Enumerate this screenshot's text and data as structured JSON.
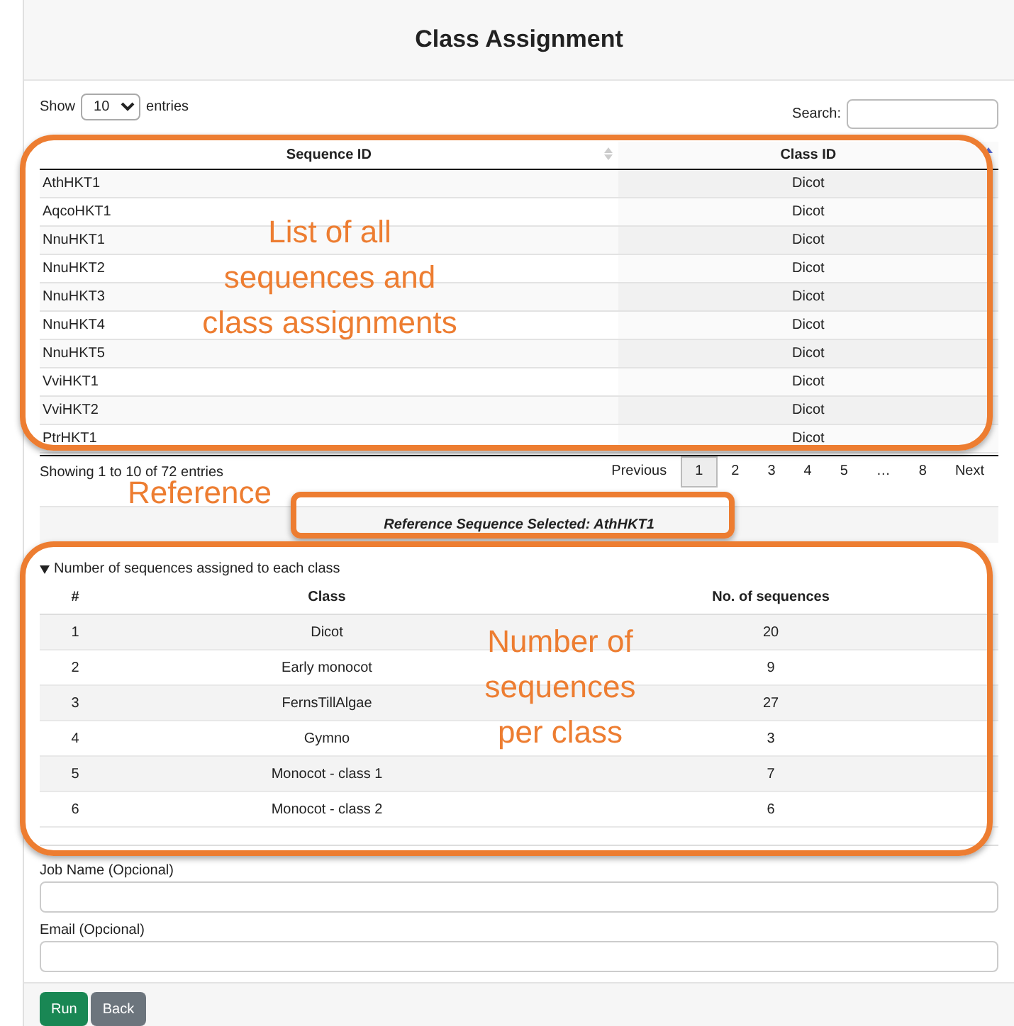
{
  "title": "Class Assignment",
  "length_menu": {
    "label_before": "Show",
    "value": "10",
    "label_after": "entries"
  },
  "search": {
    "label": "Search:"
  },
  "table": {
    "columns": [
      {
        "label": "Sequence ID",
        "sorted": false
      },
      {
        "label": "Class ID",
        "sorted": true
      }
    ],
    "rows": [
      [
        "AthHKT1",
        "Dicot"
      ],
      [
        "AqcoHKT1",
        "Dicot"
      ],
      [
        "NnuHKT1",
        "Dicot"
      ],
      [
        "NnuHKT2",
        "Dicot"
      ],
      [
        "NnuHKT3",
        "Dicot"
      ],
      [
        "NnuHKT4",
        "Dicot"
      ],
      [
        "NnuHKT5",
        "Dicot"
      ],
      [
        "VviHKT1",
        "Dicot"
      ],
      [
        "VviHKT2",
        "Dicot"
      ],
      [
        "PtrHKT1",
        "Dicot"
      ]
    ]
  },
  "info": "Showing 1 to 10 of 72 entries",
  "pagination": [
    {
      "label": "Previous",
      "selected": false
    },
    {
      "label": "1",
      "selected": true
    },
    {
      "label": "2",
      "selected": false
    },
    {
      "label": "3",
      "selected": false
    },
    {
      "label": "4",
      "selected": false
    },
    {
      "label": "5",
      "selected": false
    },
    {
      "label": "…",
      "selected": false
    },
    {
      "label": "8",
      "selected": false
    },
    {
      "label": "Next",
      "selected": false
    }
  ],
  "reference": "Reference Sequence Selected: AthHKT1",
  "counts": {
    "summary": "Number of sequences assigned to each class",
    "expanded": true,
    "columns": [
      "#",
      "Class",
      "No. of sequences"
    ],
    "rows": [
      [
        "1",
        "Dicot",
        "20"
      ],
      [
        "2",
        "Early monocot",
        "9"
      ],
      [
        "3",
        "FernsTillAlgae",
        "27"
      ],
      [
        "4",
        "Gymno",
        "3"
      ],
      [
        "5",
        "Monocot - class 1",
        "7"
      ],
      [
        "6",
        "Monocot - class 2",
        "6"
      ]
    ]
  },
  "fields": [
    {
      "label": "Job Name (Opcional)"
    },
    {
      "label": "Email (Opcional)"
    }
  ],
  "buttons": [
    {
      "label": "Run",
      "kind": "primary"
    },
    {
      "label": "Back",
      "kind": "secondary"
    }
  ],
  "annotations": {
    "table_note": "List of all sequences and class assignments",
    "reference_note": "Reference",
    "count_note": "Number of sequences per class"
  }
}
